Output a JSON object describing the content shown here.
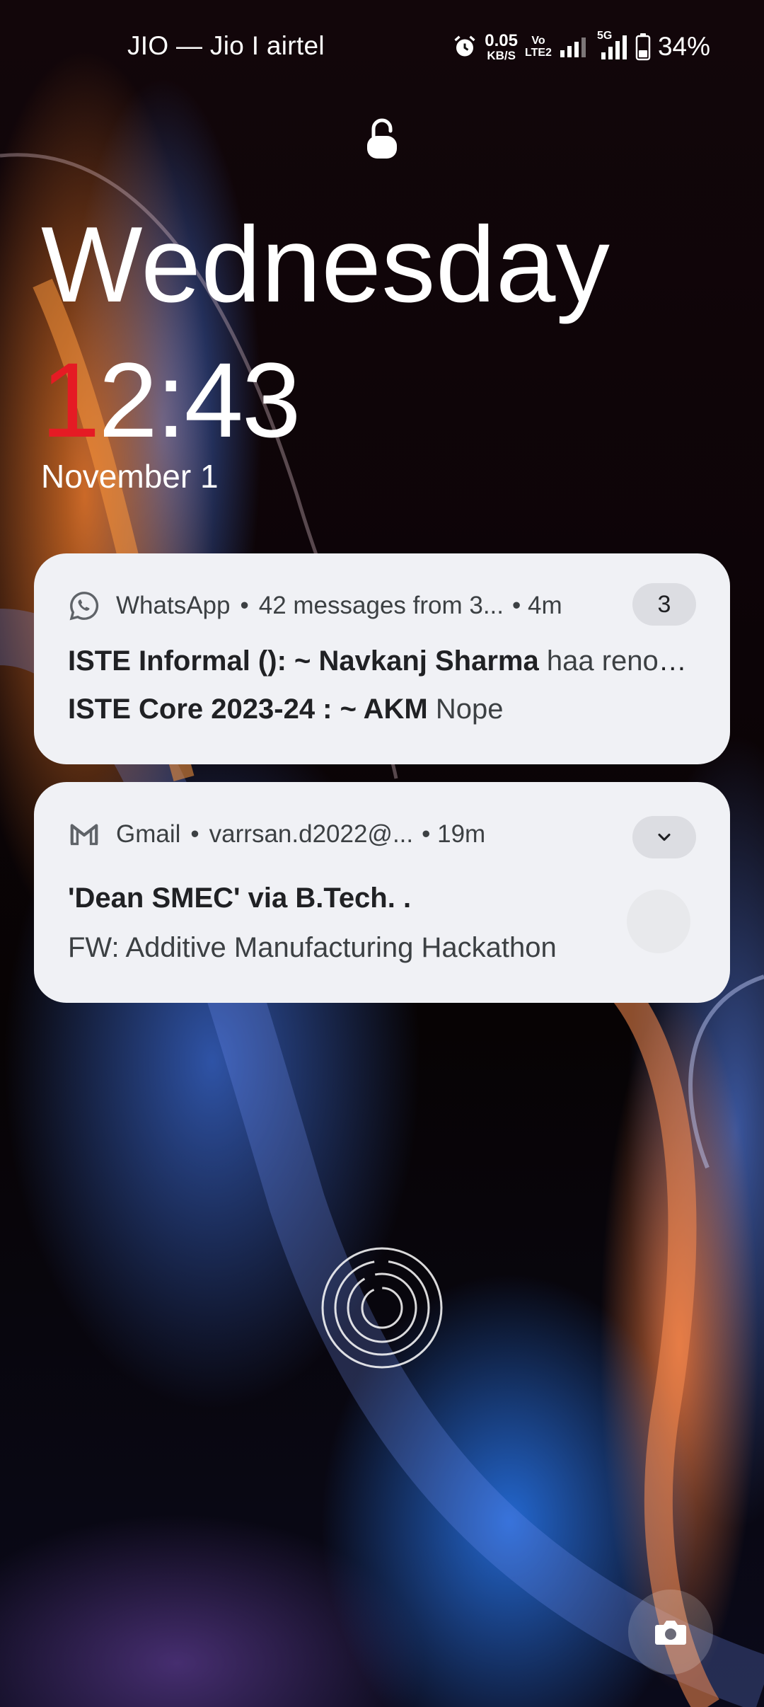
{
  "status_bar": {
    "carrier": "JIO — Jio I airtel",
    "net_speed_value": "0.05",
    "net_speed_unit": "KB/S",
    "volte_top": "Vo",
    "volte_bottom": "LTE2",
    "network_5g": "5G",
    "battery_percent": "34%",
    "icons": [
      "alarm-icon",
      "signal-icon",
      "signal-5g-icon",
      "battery-icon"
    ]
  },
  "lockscreen": {
    "day": "Wednesday",
    "time_first_digit": "1",
    "time_rest": "2:43",
    "date": "November 1",
    "accent_color": "#e51b24"
  },
  "notifications": [
    {
      "app": "WhatsApp",
      "summary": "42 messages from 3...",
      "time_ago": "4m",
      "count": "3",
      "icon": "whatsapp-icon",
      "messages": [
        {
          "sender": "ISTE Informal (): ~ Navkanj Sharma",
          "text": "haa renovation"
        },
        {
          "sender": "ISTE Core 2023-24 : ~ AKM",
          "text": "Nope"
        }
      ]
    },
    {
      "app": "Gmail",
      "account": "varrsan.d2022@...",
      "time_ago": "19m",
      "icon": "gmail-icon",
      "subject": "'Dean SMEC' via B.Tech. .",
      "body": "FW: Additive Manufacturing Hackathon"
    }
  ],
  "bottom": {
    "fingerprint_icon": "fingerprint-icon",
    "camera_icon": "camera-icon"
  }
}
